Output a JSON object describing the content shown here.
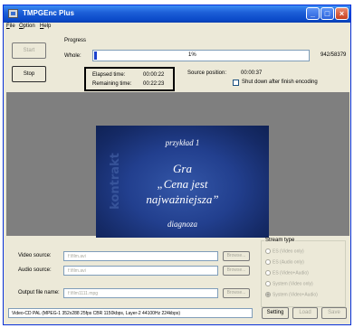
{
  "window": {
    "title": "TMPGEnc Plus"
  },
  "menu": [
    "File",
    "Option",
    "Help"
  ],
  "buttons": {
    "start": "Start",
    "stop": "Stop"
  },
  "progress": {
    "group_title": "Progress",
    "whole_label": "Whole:",
    "percent_text": "1%",
    "fraction": 0.01,
    "count": "942/58379"
  },
  "times": {
    "elapsed_label": "Elapsed time:",
    "elapsed_value": "00:00:22",
    "remaining_label": "Remaining time:",
    "remaining_value": "00:22:23",
    "source_position_label": "Source position:",
    "source_position_value": "00:00:37",
    "shutdown_label": "Shut down after finish encoding",
    "shutdown_checked": false
  },
  "preview": {
    "side_text": "kontrakt",
    "lines": [
      "przykład 1",
      "Gra",
      "„Cena jest",
      "najważniejsza”",
      "diagnoza"
    ]
  },
  "sources": {
    "video_label": "Video source:",
    "video_value": "f:\\film.avi",
    "audio_label": "Audio source:",
    "audio_value": "f:\\film.avi",
    "output_label": "Output file name:",
    "output_value": "f:\\film1111.mpg",
    "browse_label": "Browse..."
  },
  "stream_type": {
    "title": "Stream type",
    "options": [
      "ES (Video only)",
      "ES (Audio only)",
      "ES (Video+Audio)",
      "System (Video only)",
      "System (Video+Audio)"
    ],
    "selected_index": 4
  },
  "status_text": "Video-CD PAL (MPEG-1 352x288 25fps CBR 1150kbps, Layer-2 44100Hz 224kbps)",
  "bottom_buttons": {
    "setting": "Setting",
    "load": "Load",
    "save": "Save"
  },
  "colors": {
    "progress_fill": "#1c42cc",
    "preview_bg": "#7f7f7f",
    "titlebar": "#0a49c8"
  }
}
